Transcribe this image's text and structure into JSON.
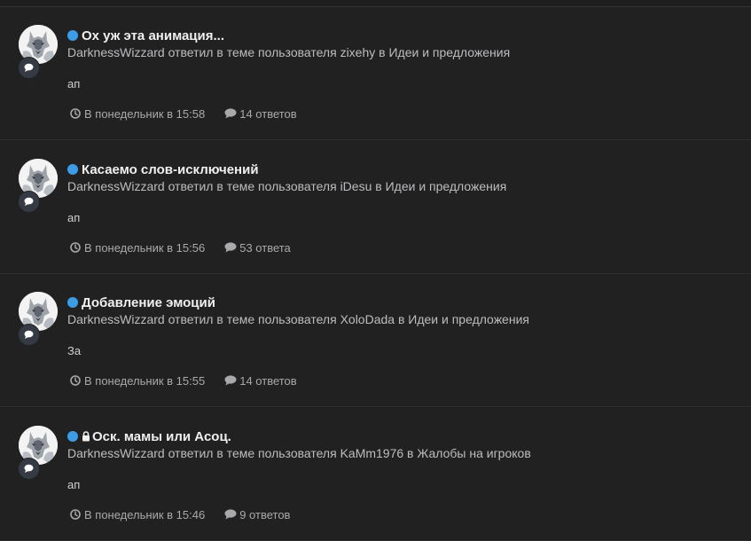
{
  "colors": {
    "background": "#1e1e1f",
    "row_background": "#212122",
    "unread_dot": "#3c9ce6",
    "title": "#f0f0f0",
    "text": "#bdbdbf",
    "meta": "#a9a9ab"
  },
  "items": [
    {
      "title": "Ох уж эта анимация...",
      "locked": false,
      "unread": true,
      "subtitle": "DarknessWizzard ответил в теме пользователя zixehy в Идеи и предложения",
      "snippet": "ап",
      "time": "В понедельник в 15:58",
      "replies": "14 ответов",
      "avatar_icon": "wolf-avatar",
      "type_icon": "comment-icon"
    },
    {
      "title": "Касаемо слов-исключений",
      "locked": false,
      "unread": true,
      "subtitle": "DarknessWizzard ответил в теме пользователя iDesu в Идеи и предложения",
      "snippet": "ап",
      "time": "В понедельник в 15:56",
      "replies": "53 ответа",
      "avatar_icon": "wolf-avatar",
      "type_icon": "comment-icon"
    },
    {
      "title": "Добавление эмоций",
      "locked": false,
      "unread": true,
      "subtitle": "DarknessWizzard ответил в теме пользователя XoloDada в Идеи и предложения",
      "snippet": "За",
      "time": "В понедельник в 15:55",
      "replies": "14 ответов",
      "avatar_icon": "wolf-avatar",
      "type_icon": "comment-icon"
    },
    {
      "title": "Оск. мамы или Асоц.",
      "locked": true,
      "unread": true,
      "subtitle": "DarknessWizzard ответил в теме пользователя KaMm1976 в Жалобы на игроков",
      "snippet": "ап",
      "time": "В понедельник в 15:46",
      "replies": "9 ответов",
      "avatar_icon": "wolf-avatar",
      "type_icon": "comment-icon"
    }
  ]
}
